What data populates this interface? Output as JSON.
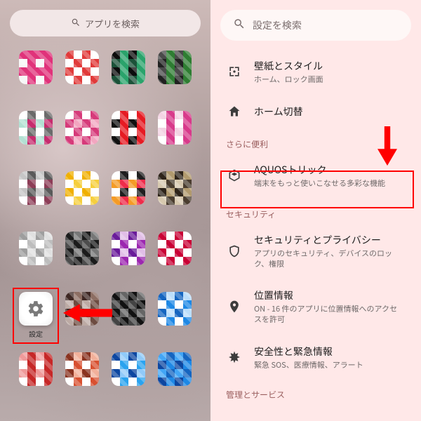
{
  "left": {
    "search_placeholder": "アプリを検索",
    "settings_label": "設定"
  },
  "right": {
    "search_placeholder": "設定を検索",
    "section_more": "さらに便利",
    "section_security": "セキュリティ",
    "footer": "管理とサービス",
    "items": {
      "wallpaper": {
        "title": "壁紙とスタイル",
        "sub": "ホーム、ロック画面"
      },
      "home": {
        "title": "ホーム切替",
        "sub": ""
      },
      "aquos": {
        "title": "AQUOSトリック",
        "sub": "端末をもっと使いこなせる多彩な機能"
      },
      "secpriv": {
        "title": "セキュリティとプライバシー",
        "sub": "アプリのセキュリティ、デバイスのロック、権限"
      },
      "location": {
        "title": "位置情報",
        "sub": "ON - 16 件のアプリに位置情報へのアクセスを許可"
      },
      "safety": {
        "title": "安全性と緊急情報",
        "sub": "緊急 SOS、医療情報、アラート"
      }
    }
  }
}
